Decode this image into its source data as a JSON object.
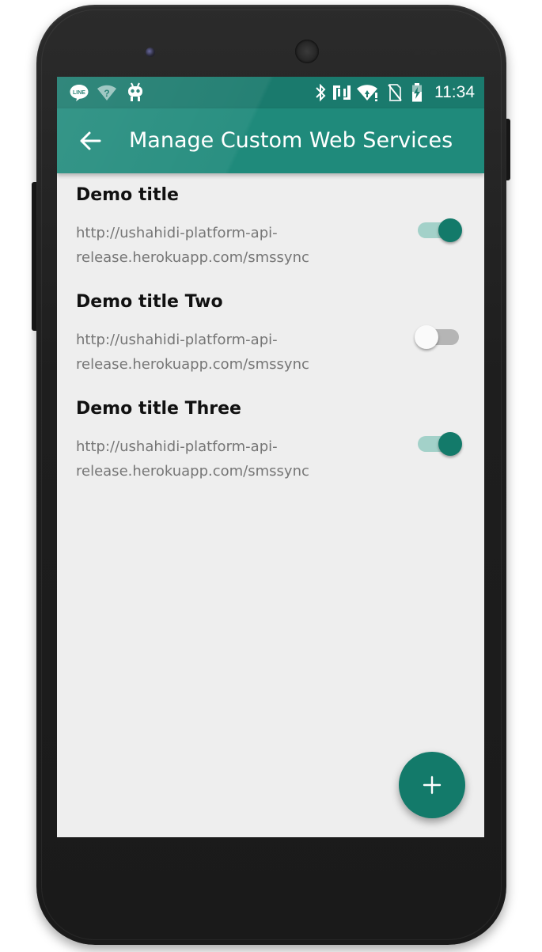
{
  "status_bar": {
    "time": "11:34",
    "left_icons": [
      "line-app-icon",
      "wifi-unknown-icon",
      "android-debug-icon"
    ],
    "right_icons": [
      "bluetooth-icon",
      "nfc-icon",
      "wifi-icon",
      "no-sim-icon",
      "battery-charging-icon"
    ]
  },
  "app_bar": {
    "back_icon": "arrow-back-icon",
    "title": "Manage Custom Web Services"
  },
  "services": [
    {
      "title": "Demo title",
      "url": "http://ushahidi-platform-api-release.herokuapp.com/smssync",
      "enabled": true
    },
    {
      "title": "Demo title Two",
      "url": "http://ushahidi-platform-api-release.herokuapp.com/smssync",
      "enabled": false
    },
    {
      "title": "Demo title Three",
      "url": "http://ushahidi-platform-api-release.herokuapp.com/smssync",
      "enabled": true
    }
  ],
  "fab": {
    "icon": "plus-icon"
  },
  "colors": {
    "primary": "#1f8a7b",
    "primary_dark": "#1a7a6d",
    "accent": "#137a6a",
    "background": "#eeeeee"
  }
}
